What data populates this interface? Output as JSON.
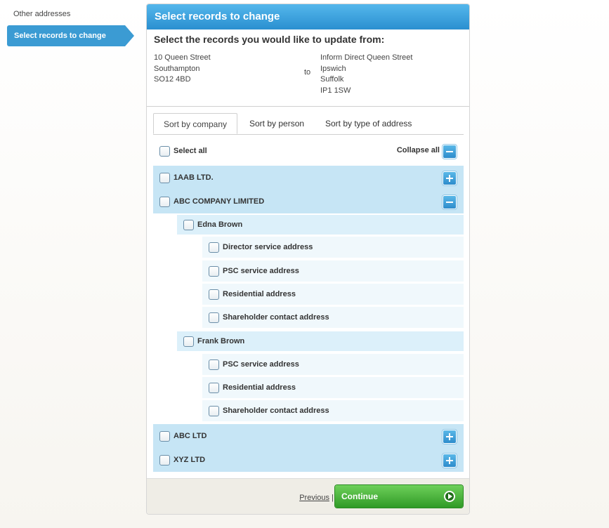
{
  "sidebar": {
    "other_addresses": "Other addresses",
    "select_records": "Select records to change"
  },
  "panel": {
    "title": "Select records to change",
    "intro": "Select the records you would like to update from:",
    "from_address": [
      "10 Queen Street",
      "Southampton",
      "SO12 4BD"
    ],
    "to_word": "to",
    "to_address": [
      "Inform Direct Queen Street",
      "Ipswich",
      "Suffolk",
      "IP1 1SW"
    ]
  },
  "tabs": [
    "Sort by company",
    "Sort by person",
    "Sort by type of address"
  ],
  "controls": {
    "select_all": "Select all",
    "collapse_all": "Collapse all"
  },
  "tree": {
    "company_1": "1AAB LTD.",
    "company_2": "ABC COMPANY LIMITED",
    "person_1": "Edna Brown",
    "person_1_records": [
      "Director service address",
      "PSC service address",
      "Residential address",
      "Shareholder contact address"
    ],
    "person_2": "Frank Brown",
    "person_2_records": [
      "PSC service address",
      "Residential address",
      "Shareholder contact address"
    ],
    "company_3": "ABC LTD",
    "company_4": "XYZ LTD"
  },
  "footer": {
    "previous": "Previous",
    "separator": "|",
    "continue": "Continue"
  }
}
